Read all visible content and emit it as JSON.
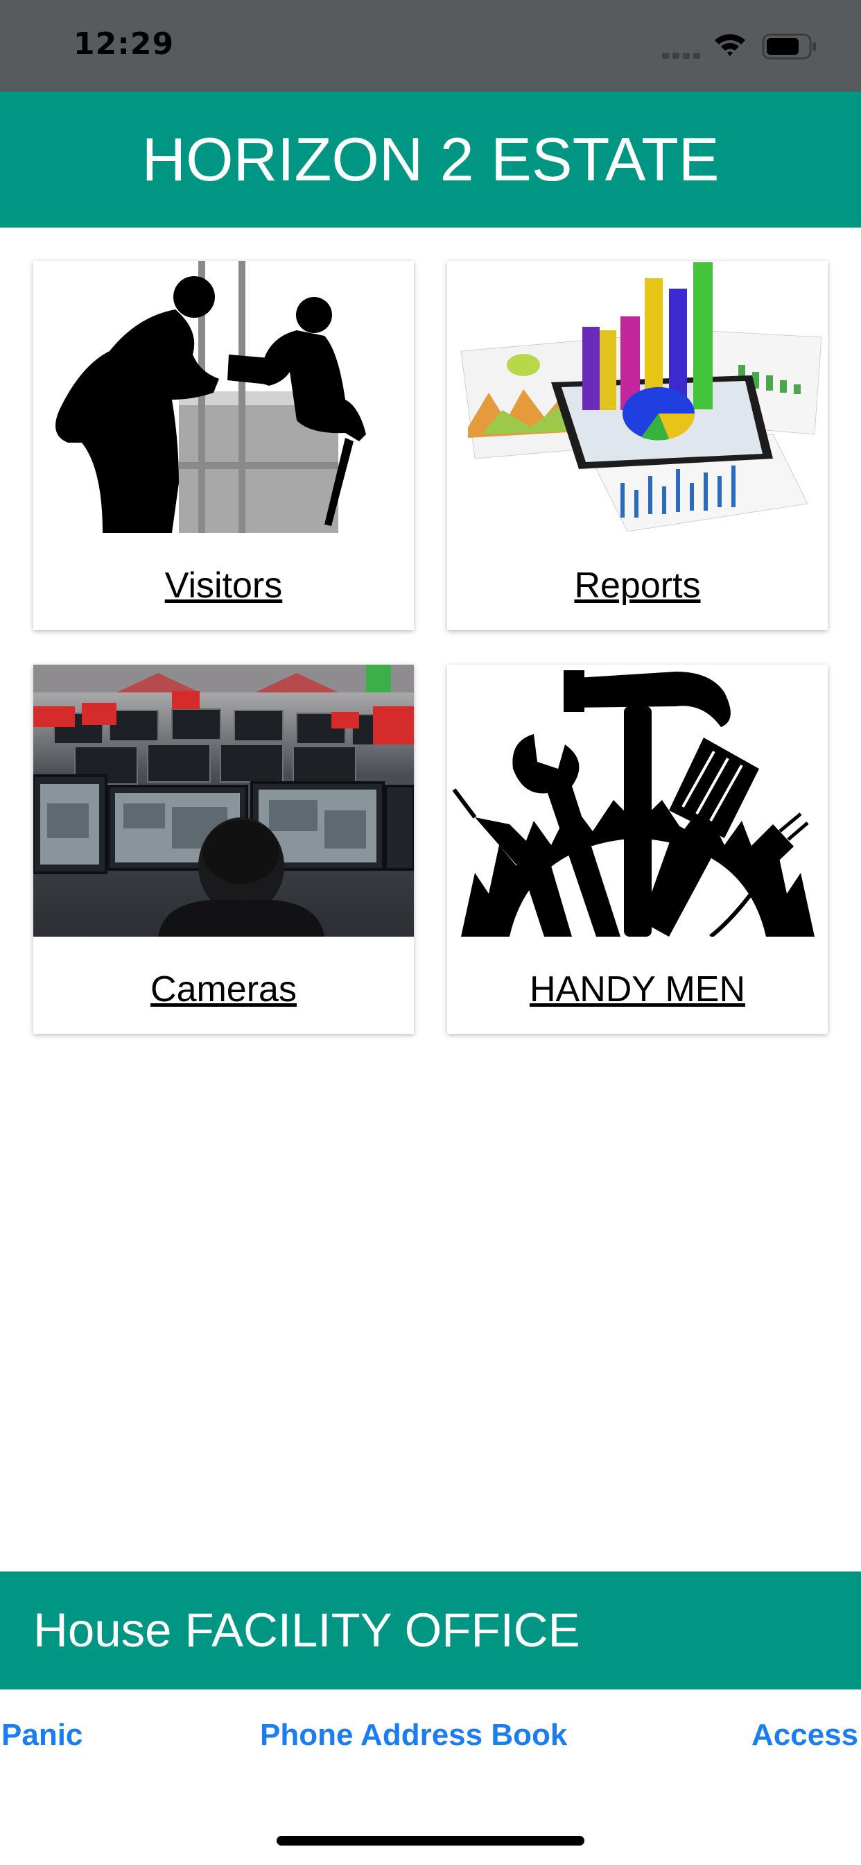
{
  "status_bar": {
    "time": "12:29"
  },
  "header": {
    "title": "HORIZON 2 ESTATE"
  },
  "tiles": [
    {
      "label": "Visitors",
      "image": "visitors-image"
    },
    {
      "label": "Reports",
      "image": "reports-image"
    },
    {
      "label": "Cameras",
      "image": "cameras-image"
    },
    {
      "label": "HANDY MEN",
      "image": "handy-men-image"
    }
  ],
  "footer": {
    "title": "House FACILITY OFFICE",
    "links": [
      "Panic",
      "Phone Address Book",
      "Access"
    ]
  },
  "colors": {
    "accent": "#009684",
    "link": "#1a7df2",
    "status_bar": "#575b5e"
  }
}
